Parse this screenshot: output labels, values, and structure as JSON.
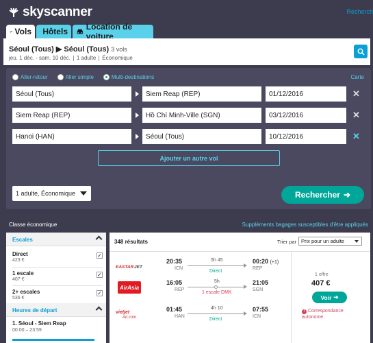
{
  "header": {
    "brand": "skyscanner",
    "top_link": "Recherch"
  },
  "tabs": [
    {
      "label": "Vols",
      "icon": "plane-icon"
    },
    {
      "label": "Hôtels",
      "icon": "bed-icon"
    },
    {
      "label": "Location de voiture",
      "icon": "car-icon"
    }
  ],
  "summary": {
    "origin": "Séoul (Tous)",
    "destination": "Séoul (Tous)",
    "flights": "3 vols",
    "dates": "jeu. 1 déc. - sam. 10 déc.",
    "travellers": "1 adulte",
    "cabin": "Économique"
  },
  "search": {
    "trip_types": [
      "Aller-retour",
      "Aller simple",
      "Multi-destinations"
    ],
    "selected_trip_type": "Multi-destinations",
    "map_link": "Carte",
    "legs": [
      {
        "from": "Séoul (Tous)",
        "to": "Siem Reap (REP)",
        "date": "01/12/2016"
      },
      {
        "from": "Siem Reap (REP)",
        "to": "Hồ Chí Minh-Ville (SGN)",
        "date": "03/12/2016"
      },
      {
        "from": "Hanoi (HAN)",
        "to": "Séoul (Tous)",
        "date": "10/12/2016"
      }
    ],
    "add_flight": "Ajouter un autre vol",
    "cabin_select": "1 adulte, Économique",
    "search_button": "Rechercher"
  },
  "results": {
    "cabin_title": "Classe économique",
    "baggage_link": "Suppléments bagages susceptibles d'être appliqués",
    "count": "348 résultats",
    "sort_label": "Trier par",
    "sort_value": "Prix pour un adulte"
  },
  "filters": {
    "stops_title": "Escales",
    "stops": [
      {
        "label": "Direct",
        "price": "423 €",
        "checked": "✓"
      },
      {
        "label": "1 escale",
        "price": "407 €",
        "checked": "✓"
      },
      {
        "label": "2+ escales",
        "price": "536 €",
        "checked": "✓"
      }
    ],
    "departure_title": "Heures de départ",
    "departure_route": "1. Séoul - Siem Reap",
    "departure_range": "00:00 – 23:59"
  },
  "card": {
    "legs": [
      {
        "airline": "EASTAR JET",
        "dep_time": "20:35",
        "dep_code": "ICN",
        "duration": "5h 45",
        "stops": "Direct",
        "arr_time": "00:20",
        "arr_plus": "(+1)",
        "arr_code": "REP"
      },
      {
        "airline": "AirAsia",
        "dep_time": "16:05",
        "dep_code": "REP",
        "duration": "5h",
        "stops": "1 escale DMK",
        "arr_time": "21:05",
        "arr_code": "SGN"
      },
      {
        "airline": "vietjetAir.com",
        "dep_time": "01:45",
        "dep_code": "HAN",
        "duration": "4h 10",
        "stops": "Direct",
        "arr_time": "07:55",
        "arr_code": "ICN"
      }
    ],
    "offers": "1 offre",
    "price": "407 €",
    "cta": "Voir",
    "warning": "Correspondance autonome"
  },
  "colors": {
    "background": "#3d3c4e",
    "accent": "#0aa0d5",
    "cta": "#00a698",
    "alert": "#d1435b"
  }
}
